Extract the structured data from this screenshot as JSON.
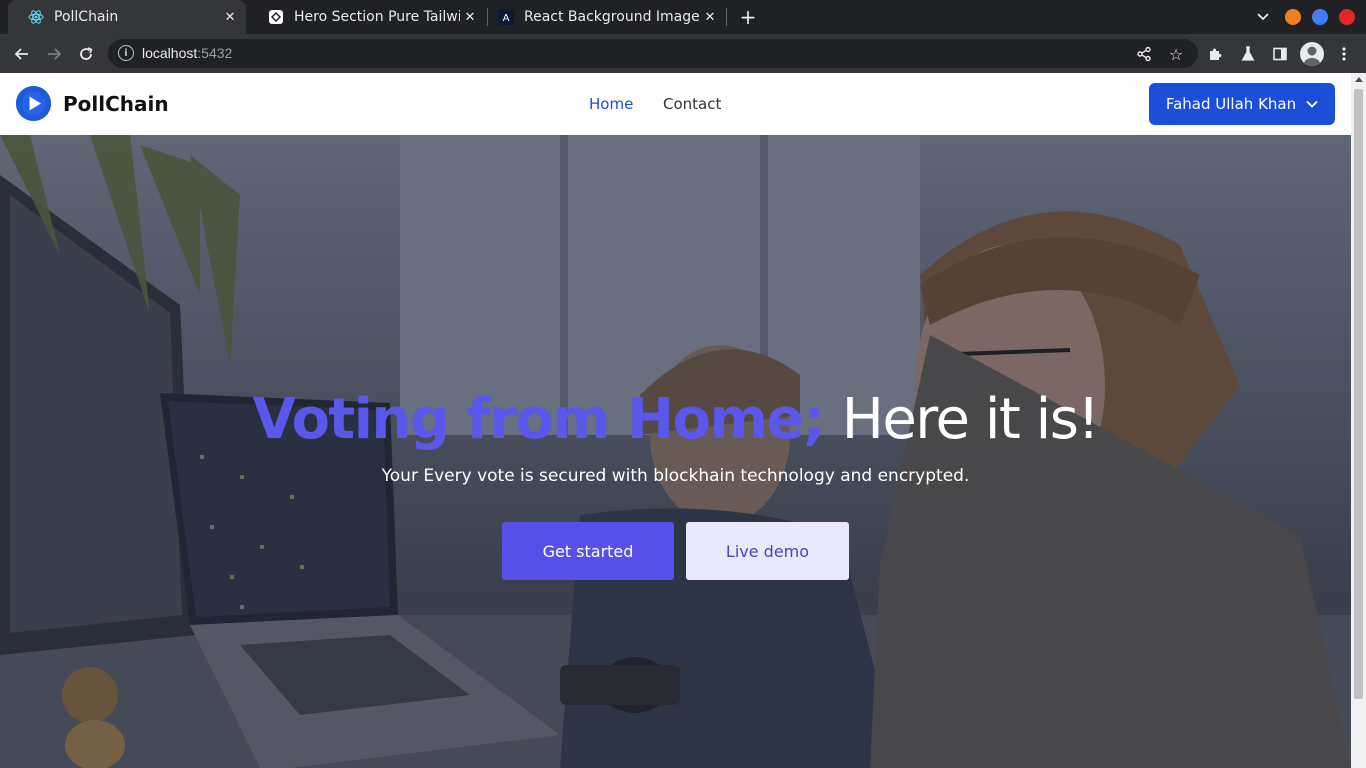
{
  "browser": {
    "tabs": [
      {
        "title": "PollChain",
        "icon": "react-icon",
        "active": true
      },
      {
        "title": "Hero Section Pure Tailwin",
        "icon": "tailwind-ui-icon",
        "active": false
      },
      {
        "title": "React Background Image",
        "icon": "angular-icon",
        "active": false
      }
    ],
    "url_host": "localhost",
    "url_port": ":5432",
    "window_colors": {
      "minimize": "#f0801e",
      "maximize": "#3f7ef2",
      "close": "#e02828"
    }
  },
  "nav": {
    "brand": "PollChain",
    "links": [
      {
        "label": "Home",
        "active": true
      },
      {
        "label": "Contact",
        "active": false
      }
    ],
    "user_name": "Fahad Ullah Khan"
  },
  "hero": {
    "headline_accent": "Voting from Home;",
    "headline_rest": "Here it is!",
    "subtitle": "Your Every vote is secured with blockhain technology and encrypted.",
    "primary_cta": "Get started",
    "secondary_cta": "Live demo"
  },
  "colors": {
    "accent": "#5b57ea",
    "brand_blue": "#1d4ed8"
  }
}
